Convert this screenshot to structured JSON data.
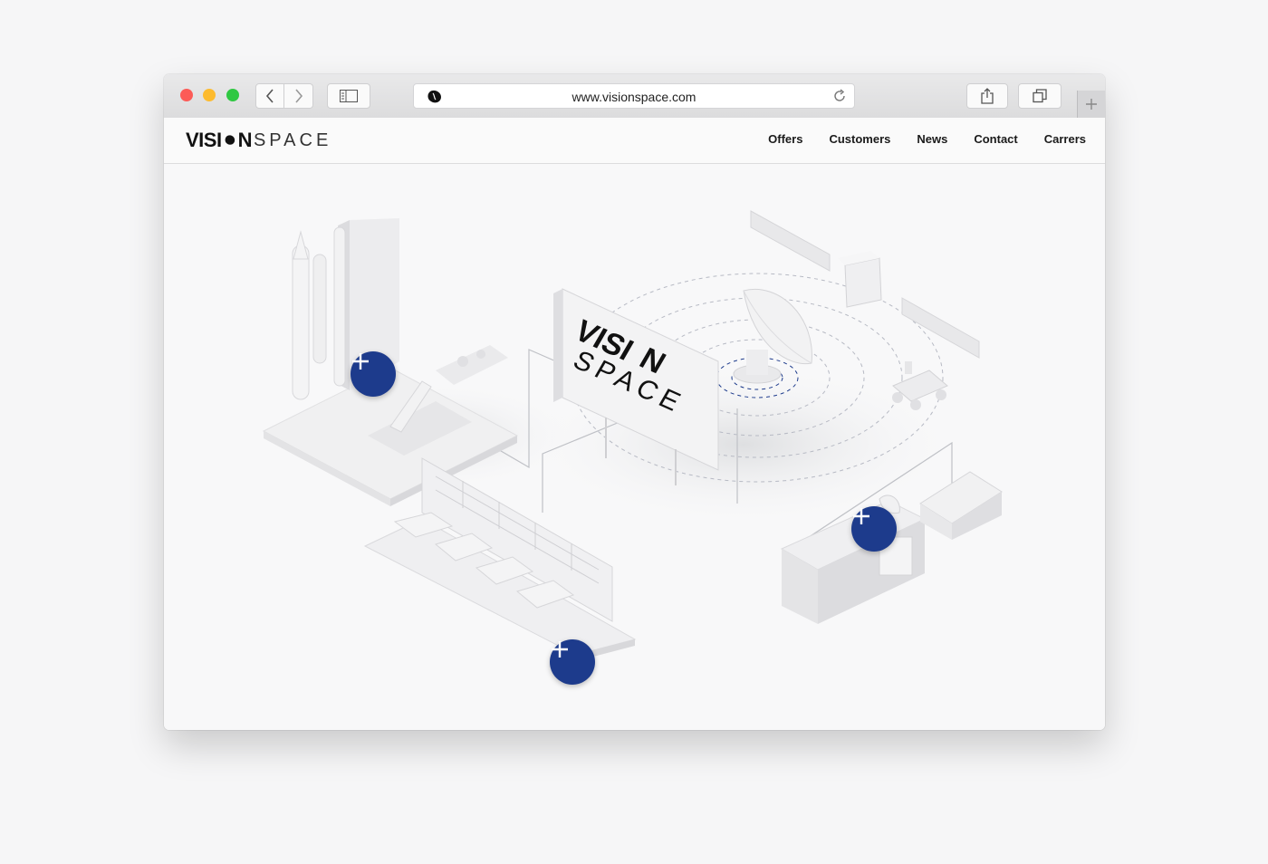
{
  "browser": {
    "url": "www.visionspace.com",
    "icons": {
      "back": "chevron-left-icon",
      "forward": "chevron-right-icon",
      "sidebar": "sidebar-icon",
      "favicon": "site-favicon-icon",
      "reload": "reload-icon",
      "share": "share-icon",
      "tabs": "tabs-overview-icon",
      "new_tab": "plus-icon"
    },
    "traffic_colors": {
      "close": "#fc5b57",
      "minimize": "#fdbb2f",
      "maximize": "#2fc842"
    }
  },
  "site": {
    "logo": {
      "bold": "VISI",
      "bold_end": "N",
      "light": "SPACE"
    },
    "nav": [
      "Offers",
      "Customers",
      "News",
      "Contact",
      "Carrers"
    ],
    "sign": {
      "line1": "VISI",
      "line1_end": "N",
      "line2": "SPACE"
    },
    "hotspots": [
      {
        "name": "launch-site-hotspot",
        "icon": "plus-icon"
      },
      {
        "name": "ground-station-hotspot",
        "icon": "plus-icon"
      },
      {
        "name": "mission-control-hotspot",
        "icon": "plus-icon"
      }
    ],
    "accent_color": "#1d3b8c"
  }
}
